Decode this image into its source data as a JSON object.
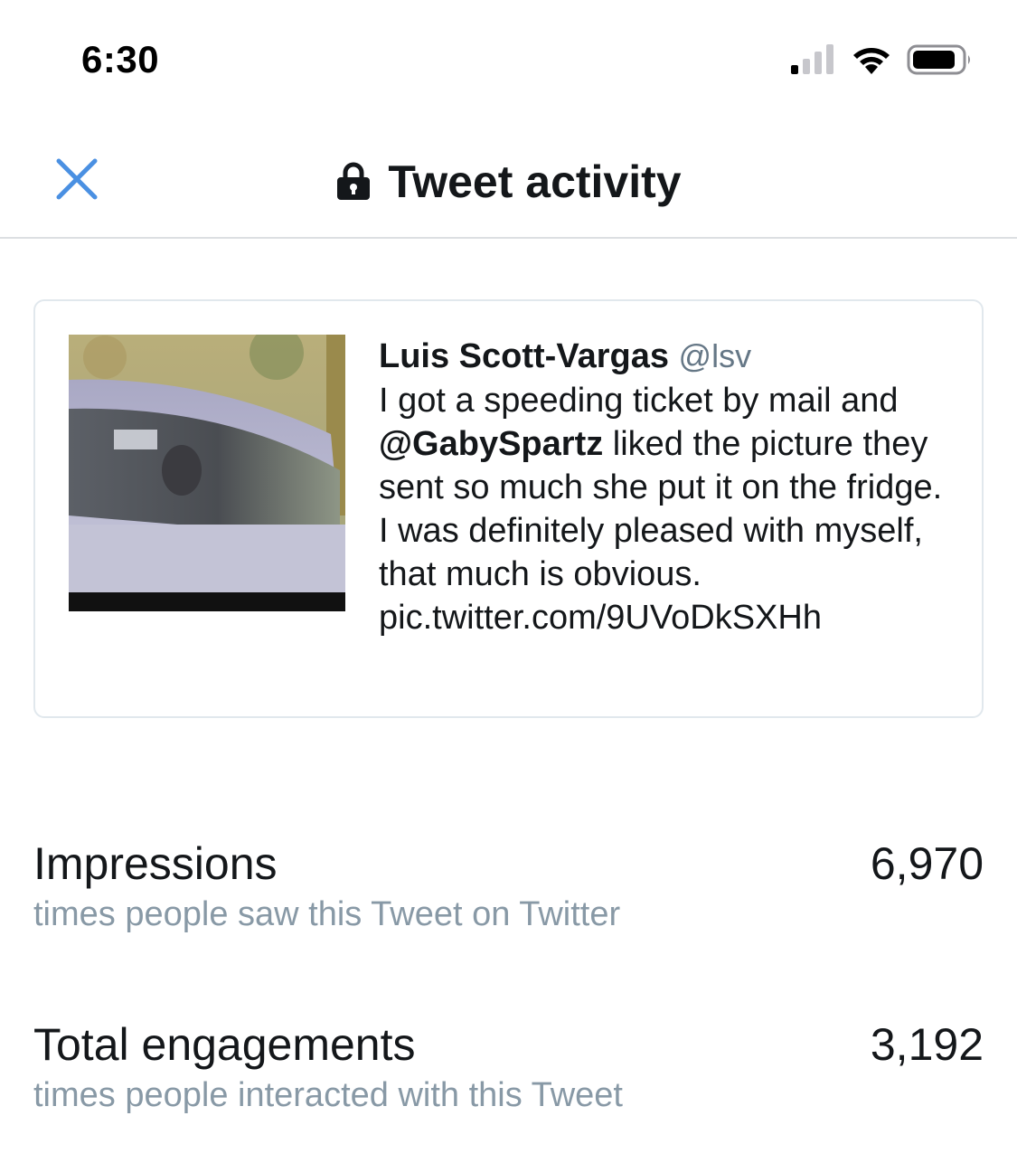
{
  "status_bar": {
    "time": "6:30",
    "icons": [
      "cellular-signal-icon",
      "wifi-icon",
      "battery-icon"
    ]
  },
  "nav": {
    "close_icon": "close-icon",
    "lock_icon": "lock-icon",
    "title": "Tweet activity",
    "accent_color": "#4a90e2"
  },
  "tweet": {
    "author_name": "Luis Scott-Vargas",
    "author_handle": "@lsv",
    "text_before_mention": "I got a speeding ticket by mail and ",
    "mention": "@GabySpartz",
    "text_after_mention": " liked the picture they sent so much she put it on the fridge. I was definitely pleased with myself, that much is obvious.",
    "link": "pic.twitter.com/9UVoDkSXHh",
    "media_description_icon": "tweet-photo"
  },
  "metrics": [
    {
      "label": "Impressions",
      "description": "times people saw this Tweet on Twitter",
      "value": "6,970"
    },
    {
      "label": "Total engagements",
      "description": "times people interacted with this Tweet",
      "value": "3,192"
    }
  ],
  "colors": {
    "primary_text": "#14171a",
    "secondary_text": "#8899a6",
    "handle_text": "#657786",
    "divider": "#dcdfe2",
    "card_border": "#e1e8ed"
  }
}
